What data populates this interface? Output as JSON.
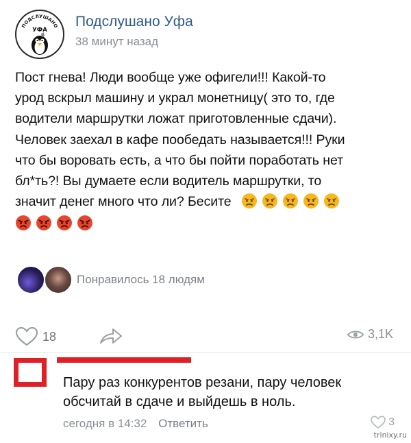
{
  "post": {
    "group_name": "Подслушано Уфа",
    "avatar_text_top": "ПОДСЛУШАНО",
    "avatar_text_bottom": "УФА",
    "time": "38 минут назад",
    "text_lines": [
      "Пост гнева! Люди вообще уже офигели!!! Какой-то",
      "урод вскрыл машину и украл монетницу( это то, где",
      "водители маршрутки ложат приготовленные сдачи).",
      "Человек заехал в кафе пообедать называется!!! Руки",
      "что бы воровать есть, а что бы пойти поработать  нет",
      "бл*ть?! Вы думаете если водитель маршрутки, то",
      "значит денег много что ли? Бесите"
    ],
    "emoji": {
      "annoyed_count": 5,
      "angry_count": 4,
      "annoyed_icon": "annoyed-face-emoji",
      "angry_icon": "angry-face-emoji"
    },
    "liked_by": "Понравилось 18 людям",
    "likes_count": "18",
    "views_count": "3,1K",
    "icons": {
      "like": "heart-icon",
      "share": "share-arrow-icon",
      "views": "eye-icon"
    }
  },
  "comment": {
    "text_lines": [
      "Пару раз конкурентов резани, пару человек",
      "обсчитай в сдаче и выйдешь в ноль."
    ],
    "time": "сегодня в 14:32",
    "reply_label": "Ответить",
    "likes": "3"
  },
  "watermark": "trinixy.ru",
  "colors": {
    "link": "#2f5a8c",
    "muted": "#8a8f96",
    "redaction": "#e02027",
    "emoji_yellow": "#f6b71f",
    "emoji_red": "#e8452c"
  }
}
